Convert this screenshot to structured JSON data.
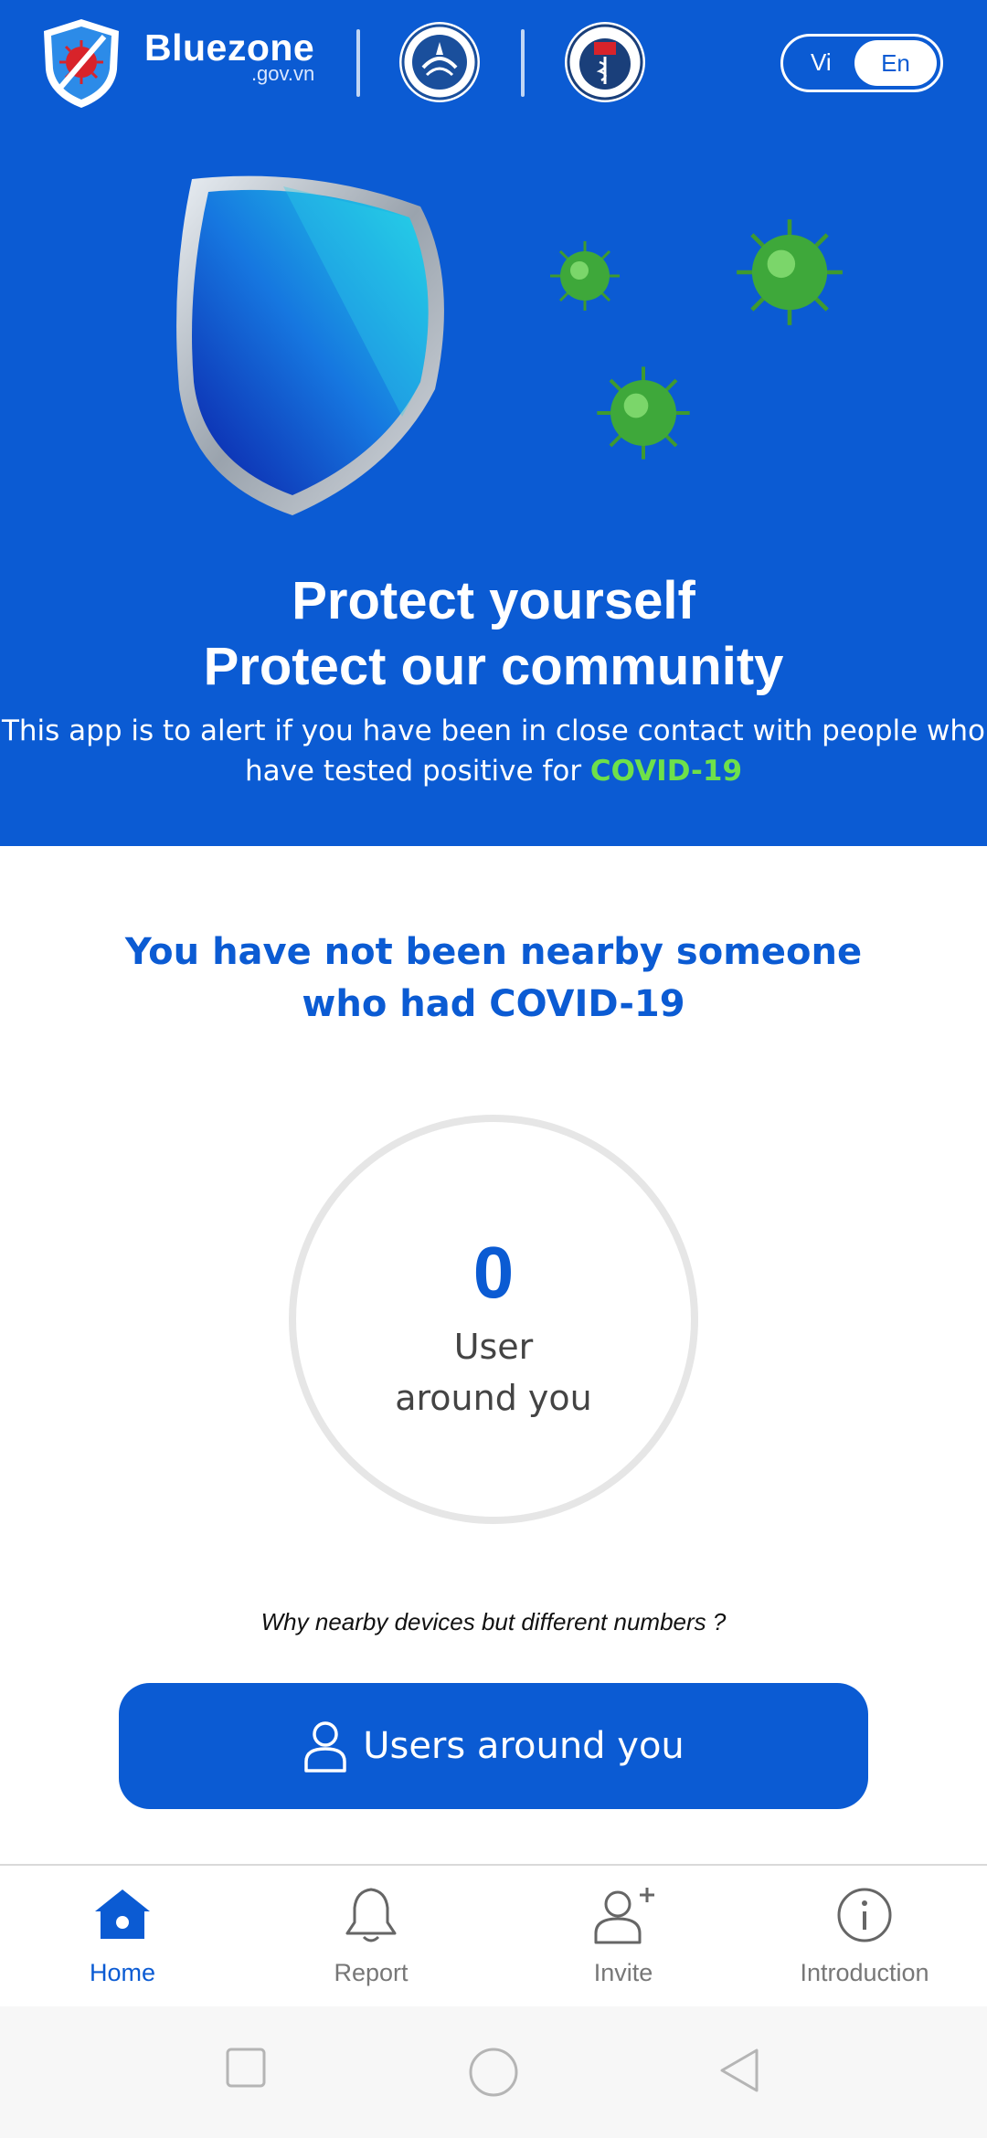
{
  "header": {
    "brand_name": "Bluezone",
    "brand_domain": ".gov.vn",
    "language_toggle": {
      "options": [
        "Vi",
        "En"
      ],
      "selected": "En"
    }
  },
  "hero": {
    "headline_line1": "Protect yourself",
    "headline_line2": "Protect our community",
    "subtext_before": "This app is to alert if you have been in close contact with people who have tested positive for",
    "subtext_highlight": "COVID-19"
  },
  "status": {
    "title_line1": "You have not been nearby someone",
    "title_line2": "who had COVID-19",
    "count": "0",
    "count_label_line1": "User",
    "count_label_line2": "around you"
  },
  "help_link": "Why nearby devices but different numbers ?",
  "users_button_label": "Users around you",
  "bottom_nav": {
    "items": [
      {
        "label": "Home",
        "icon": "home-icon",
        "active": true
      },
      {
        "label": "Report",
        "icon": "bell-icon",
        "active": false
      },
      {
        "label": "Invite",
        "icon": "add-user-icon",
        "active": false
      },
      {
        "label": "Introduction",
        "icon": "info-icon",
        "active": false
      }
    ]
  },
  "colors": {
    "brand_blue": "#0b5bd3",
    "covid_green": "#6ee04a",
    "ring_gray": "#e6e6e6",
    "nav_inactive": "#777777"
  }
}
